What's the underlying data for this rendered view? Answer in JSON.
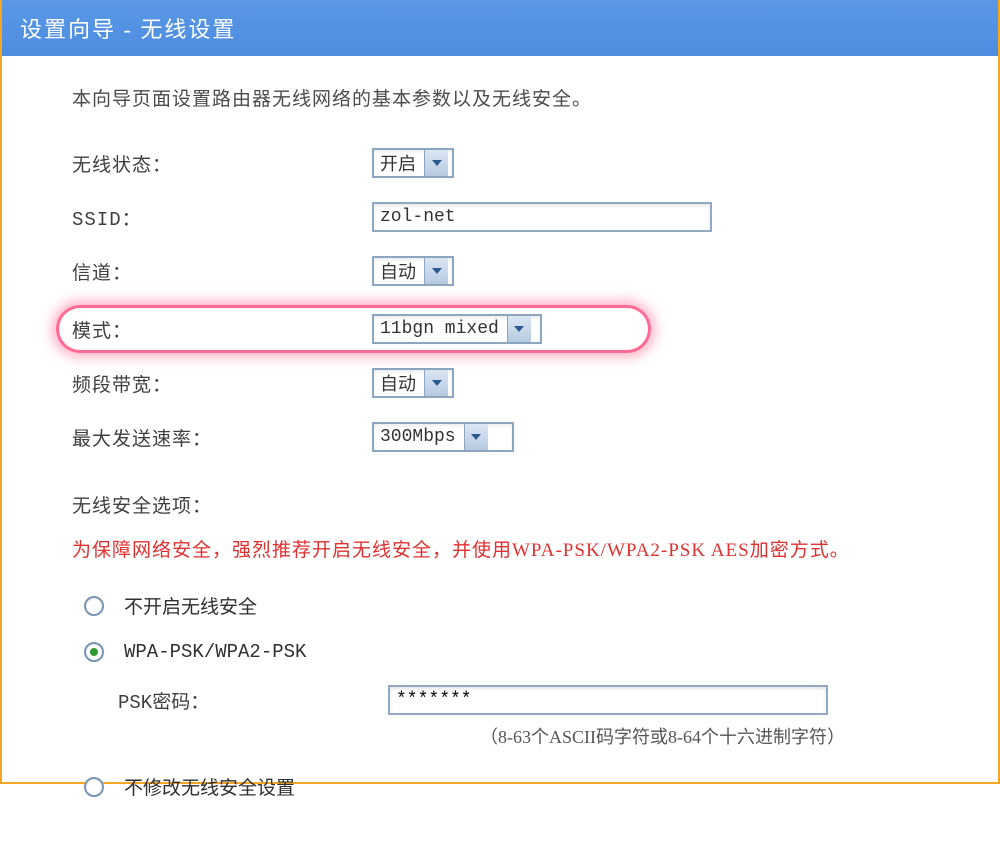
{
  "header": {
    "title": "设置向导 - 无线设置"
  },
  "intro": "本向导页面设置路由器无线网络的基本参数以及无线安全。",
  "form": {
    "wireless_status": {
      "label": "无线状态：",
      "value": "开启"
    },
    "ssid": {
      "label": "SSID：",
      "value": "zol-net"
    },
    "channel": {
      "label": "信道：",
      "value": "自动"
    },
    "mode": {
      "label": "模式：",
      "value": "11bgn mixed"
    },
    "bandwidth": {
      "label": "频段带宽：",
      "value": "自动"
    },
    "max_rate": {
      "label": "最大发送速率：",
      "value": "300Mbps"
    }
  },
  "security": {
    "section_label": "无线安全选项：",
    "warning": "为保障网络安全，强烈推荐开启无线安全，并使用WPA-PSK/WPA2-PSK AES加密方式。",
    "options": {
      "disable": "不开启无线安全",
      "wpa": "WPA-PSK/WPA2-PSK",
      "keep": "不修改无线安全设置"
    },
    "psk": {
      "label": "PSK密码：",
      "value": "*******",
      "hint": "（8-63个ASCII码字符或8-64个十六进制字符）"
    }
  }
}
